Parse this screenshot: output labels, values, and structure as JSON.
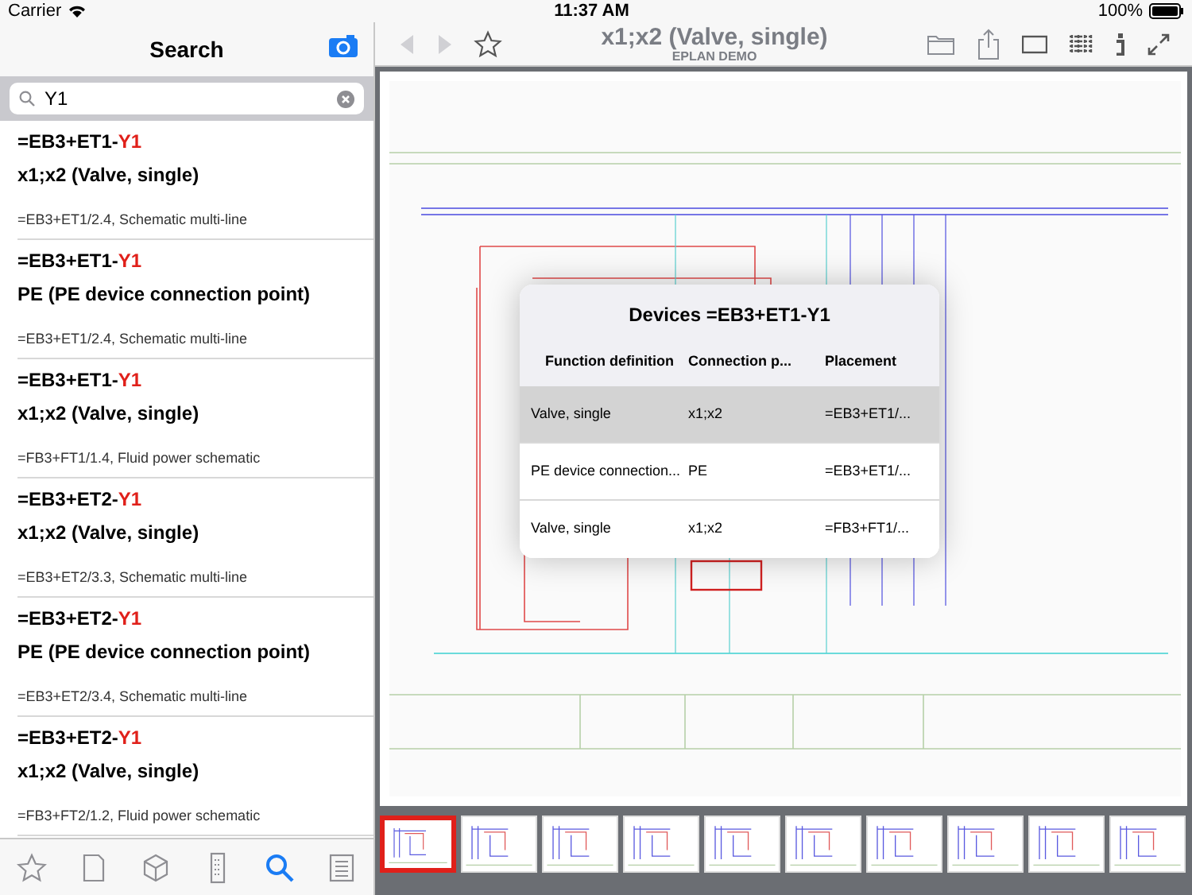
{
  "status_bar": {
    "carrier": "Carrier",
    "time": "11:37 AM",
    "battery": "100%"
  },
  "sidebar": {
    "title": "Search",
    "search": {
      "value": "Y1"
    },
    "results": [
      {
        "device_prefix": "=EB3+ET1-",
        "match": "Y1",
        "name": "x1;x2 (Valve, single)",
        "location": "=EB3+ET1/2.4, Schematic multi-line"
      },
      {
        "device_prefix": "=EB3+ET1-",
        "match": "Y1",
        "name": "PE (PE device connection point)",
        "location": "=EB3+ET1/2.4, Schematic multi-line"
      },
      {
        "device_prefix": "=EB3+ET1-",
        "match": "Y1",
        "name": "x1;x2 (Valve, single)",
        "location": "=FB3+FT1/1.4, Fluid power schematic"
      },
      {
        "device_prefix": "=EB3+ET2-",
        "match": "Y1",
        "name": "x1;x2 (Valve, single)",
        "location": "=EB3+ET2/3.3, Schematic multi-line"
      },
      {
        "device_prefix": "=EB3+ET2-",
        "match": "Y1",
        "name": "PE (PE device connection point)",
        "location": "=EB3+ET2/3.4, Schematic multi-line"
      },
      {
        "device_prefix": "=EB3+ET2-",
        "match": "Y1",
        "name": "x1;x2 (Valve, single)",
        "location": "=FB3+FT2/1.2, Fluid power schematic"
      }
    ],
    "tabs": [
      {
        "kind": "favorites",
        "selected": false
      },
      {
        "kind": "pages",
        "selected": false
      },
      {
        "kind": "parts",
        "selected": false
      },
      {
        "kind": "structure",
        "selected": false
      },
      {
        "kind": "search",
        "selected": true
      },
      {
        "kind": "list",
        "selected": false
      }
    ]
  },
  "toolbar": {
    "title": "x1;x2 (Valve, single)",
    "subtitle": "EPLAN DEMO",
    "back_disabled": true,
    "forward_disabled": true
  },
  "popover": {
    "title": "Devices =EB3+ET1-Y1",
    "columns": [
      "Function definition",
      "Connection p...",
      "Placement"
    ],
    "rows": [
      {
        "cells": [
          "Valve, single",
          "x1;x2",
          "=EB3+ET1/..."
        ],
        "selected": true
      },
      {
        "cells": [
          "PE device connection...",
          "PE",
          "=EB3+ET1/..."
        ],
        "selected": false
      },
      {
        "cells": [
          "Valve, single",
          "x1;x2",
          "=FB3+FT1/..."
        ],
        "selected": false
      }
    ]
  },
  "thumbnails": [
    {
      "selected": true
    },
    {
      "selected": false
    },
    {
      "selected": false
    },
    {
      "selected": false
    },
    {
      "selected": false
    },
    {
      "selected": false
    },
    {
      "selected": false
    },
    {
      "selected": false
    },
    {
      "selected": false
    },
    {
      "selected": false
    }
  ]
}
